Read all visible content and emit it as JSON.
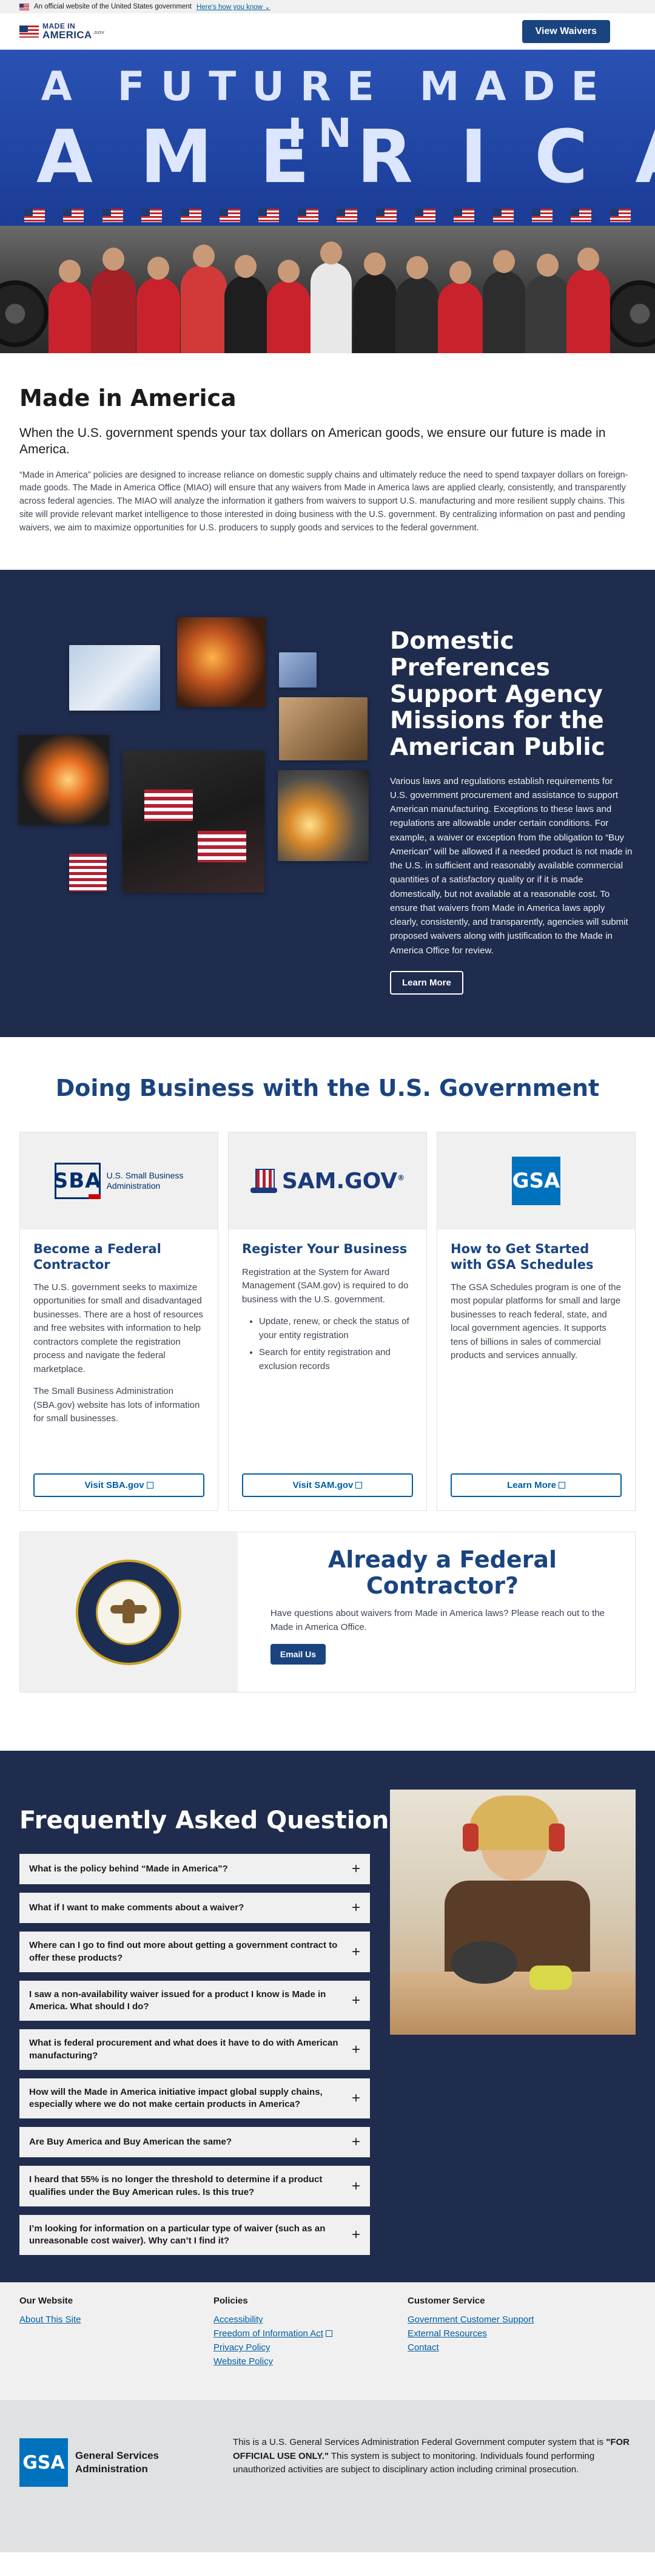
{
  "gov_banner": {
    "text": "An official website of the United States government",
    "link": "Here's how you know"
  },
  "header": {
    "logo_top": "MADE IN",
    "logo_bottom": "AMERICA",
    "logo_suffix": ".GOV",
    "cta": "View Waivers"
  },
  "hero": {
    "line1": "A FUTURE MADE IN",
    "line2": "AMERICA"
  },
  "intro": {
    "title": "Made in America",
    "lead": "When the U.S. government spends your tax dollars on American goods, we ensure our future is made in America.",
    "body": "“Made in America” policies are designed to increase reliance on domestic supply chains and ultimately reduce the need to spend taxpayer dollars on foreign-made goods. The Made in America Office (MIAO) will ensure that any waivers from Made in America laws are applied clearly, consistently, and transparently across federal agencies. The MIAO will analyze the information it gathers from waivers to support U.S. manufacturing and more resilient supply chains. This site will provide relevant market intelligence to those interested in doing business with the U.S. government. By centralizing information on past and pending waivers, we aim to maximize opportunities for U.S. producers to supply goods and services to the federal government."
  },
  "prefs": {
    "title": "Domestic Preferences Support Agency Missions for the American Public",
    "body": "Various laws and regulations establish requirements for U.S. government procurement and assistance to support American manufacturing. Exceptions to these laws and regulations are allowable under certain conditions. For example, a waiver or exception from the obligation to “Buy American” will be allowed if a needed product is not made in the U.S. in sufficient and reasonably available commercial quantities of a satisfactory quality or if it is made domestically, but not available at a reasonable cost. To ensure that waivers from Made in America laws apply clearly, consistently, and transparently, agencies will submit proposed waivers along with justification to the Made in America Office for review.",
    "button": "Learn More"
  },
  "business": {
    "title": "Doing Business with the U.S. Government",
    "cards": [
      {
        "logo_mark": "SBA",
        "logo_text_1": "U.S. Small Business",
        "logo_text_2": "Administration",
        "title": "Become a Federal Contractor",
        "p1": "The U.S. government seeks to maximize opportunities for small and disadvantaged businesses. There are a host of resources and free websites with information to help contractors complete the registration process and navigate the federal marketplace.",
        "p2": "The Small Business Administration (SBA.gov) website has lots of information for small businesses.",
        "button": "Visit SBA.gov"
      },
      {
        "logo_text": "SAM.GOV",
        "logo_reg": "®",
        "title": "Register Your Business",
        "p1": "Registration at the System for Award Management (SAM.gov) is required to do business with the U.S. government.",
        "bullets": [
          "Update, renew, or check the status of your entity registration",
          "Search for entity registration and exclusion records"
        ],
        "button": "Visit SAM.gov"
      },
      {
        "logo_mark": "GSA",
        "title": "How to Get Started with GSA Schedules",
        "p1": "The GSA Schedules program is one of the most popular platforms for small and large businesses to reach federal, state, and local government agencies. It supports tens of billions in sales of commercial products and services annually.",
        "button": "Learn More"
      }
    ]
  },
  "already": {
    "title": "Already a Federal Contractor?",
    "body": "Have questions about waivers from Made in America laws? Please reach out to the Made in America Office.",
    "button": "Email Us"
  },
  "faq": {
    "title": "Frequently Asked Questions",
    "items": [
      "What is the policy behind “Made in America”?",
      "What if I want to make comments about a waiver?",
      "Where can I go to find out more about getting a government contract to offer these products?",
      "I saw a non-availability waiver issued for a product I know is Made in America. What should I do?",
      "What is federal procurement and what does it have to do with American manufacturing?",
      "How will the Made in America initiative impact global supply chains, especially where we do not make certain products in America?",
      "Are Buy America and Buy American the same?",
      "I heard that 55% is no longer the threshold to determine if a product qualifies under the Buy American rules. Is this true?",
      "I’m looking for information on a particular type of waiver (such as an unreasonable cost waiver). Why can’t I find it?"
    ]
  },
  "footer": {
    "col1": {
      "title": "Our Website",
      "links": [
        "About This Site"
      ]
    },
    "col2": {
      "title": "Policies",
      "links": [
        "Accessibility",
        "Freedom of Information Act",
        "Privacy Policy",
        "Website Policy"
      ]
    },
    "col3": {
      "title": "Customer Service",
      "links": [
        "Government Customer Support",
        "External Resources",
        "Contact"
      ]
    },
    "gsa_mark": "GSA",
    "gsa_name_1": "General Services",
    "gsa_name_2": "Administration",
    "disclaimer_1": "This is a U.S. General Services Administration Federal Government computer system that is ",
    "disclaimer_strong": "\"FOR OFFICIAL USE ONLY.\"",
    "disclaimer_2": " This system is subject to monitoring. Individuals found performing unauthorized activities are subject to disciplinary action including criminal prosecution."
  },
  "colors": {
    "navy": "#1f2c4d",
    "primary": "#1a4480",
    "link": "#005ea2",
    "light_gray": "#f0f0f0"
  }
}
